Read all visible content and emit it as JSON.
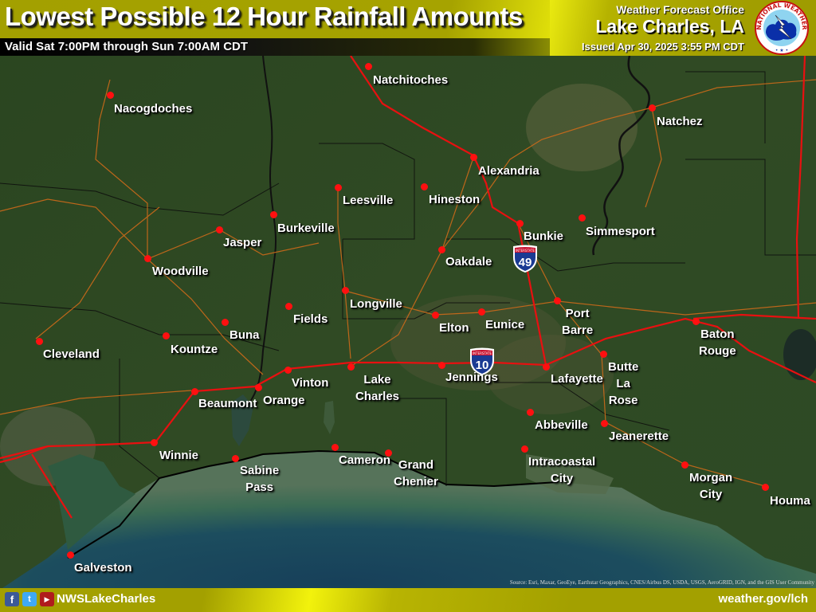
{
  "header": {
    "title": "Lowest Possible 12 Hour Rainfall Amounts",
    "valid": "Valid Sat 7:00PM through Sun 7:00AM CDT",
    "office_line1": "Weather Forecast Office",
    "office_line2": "Lake Charles, LA",
    "issued": "Issued Apr 30, 2025 3:55 PM CDT",
    "logo_text_top": "NATIONAL WEATHER",
    "logo_text_bottom": "SERVICE"
  },
  "footer": {
    "social_handle": "NWSLakeCharles",
    "website": "weather.gov/lch",
    "icons": [
      "facebook-icon",
      "twitter-icon",
      "youtube-icon"
    ],
    "facebook_glyph": "f",
    "twitter_glyph": "t",
    "youtube_glyph": "▶"
  },
  "map": {
    "attribution": "Source: Esri, Maxar, GeoEye, Earthstar Geographics, CNES/Airbus DS, USDA, USGS, AeroGRID, IGN, and the GIS User Community",
    "interstate_shields": [
      {
        "label": "INTERSTATE",
        "number": "49"
      },
      {
        "label": "INTERSTATE",
        "number": "10"
      }
    ],
    "cities": [
      {
        "name": "Natchitoches"
      },
      {
        "name": "Nacogdoches"
      },
      {
        "name": "Natchez"
      },
      {
        "name": "Alexandria"
      },
      {
        "name": "Leesville"
      },
      {
        "name": "Hineston"
      },
      {
        "name": "Burkeville"
      },
      {
        "name": "Jasper"
      },
      {
        "name": "Bunkie"
      },
      {
        "name": "Simmesport"
      },
      {
        "name": "Woodville"
      },
      {
        "name": "Oakdale"
      },
      {
        "name": "Longville"
      },
      {
        "name": "Fields"
      },
      {
        "name": "Elton"
      },
      {
        "name": "Eunice"
      },
      {
        "name": "Port\nBarre"
      },
      {
        "name": "Baton\nRouge"
      },
      {
        "name": "Cleveland"
      },
      {
        "name": "Kountze"
      },
      {
        "name": "Buna"
      },
      {
        "name": "Vinton"
      },
      {
        "name": "Lake\nCharles"
      },
      {
        "name": "Jennings"
      },
      {
        "name": "Lafayette"
      },
      {
        "name": "Butte\nLa\nRose"
      },
      {
        "name": "Beaumont"
      },
      {
        "name": "Orange"
      },
      {
        "name": "Abbeville"
      },
      {
        "name": "Jeanerette"
      },
      {
        "name": "Winnie"
      },
      {
        "name": "Sabine\nPass"
      },
      {
        "name": "Cameron"
      },
      {
        "name": "Grand\nChenier"
      },
      {
        "name": "Intracoastal\nCity"
      },
      {
        "name": "Morgan\nCity"
      },
      {
        "name": "Houma"
      },
      {
        "name": "Galveston"
      }
    ]
  },
  "colors": {
    "header_olive": "#a3a000",
    "header_highlight": "#f4f40d",
    "city_dot": "#ff1010",
    "interstate_red": "#e81010",
    "highway_orange": "#d2691e",
    "water": "#1d4a5c",
    "land": "#2b4a22"
  }
}
